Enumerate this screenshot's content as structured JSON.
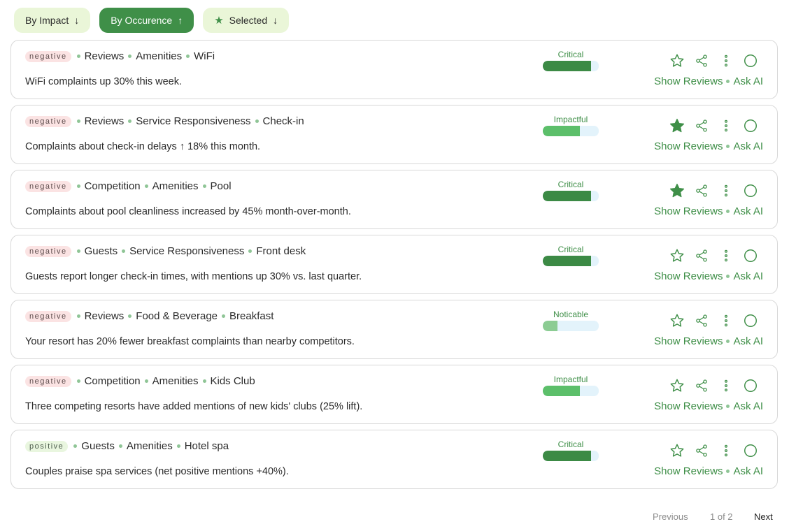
{
  "sort": {
    "by_impact": "By Impact",
    "by_impact_arrow": "↓",
    "by_occurence": "By Occurence",
    "by_occurence_arrow": "↑",
    "selected": "Selected",
    "selected_arrow": "↓",
    "active": "by_occurence"
  },
  "colors": {
    "accent": "#3f8f48",
    "critical": "#3c8a45",
    "impactful": "#5cbf6a",
    "noticable": "#8ccc93",
    "bar_track": "#e3f3fb"
  },
  "links": {
    "show_reviews": "Show Reviews",
    "ask_ai": "Ask AI"
  },
  "insights": [
    {
      "sentiment": "negative",
      "source": "Reviews",
      "category": "Amenities",
      "topic": "WiFi",
      "description": "WiFi complaints up 30% this week.",
      "impact": "Critical",
      "level": 0.86,
      "starred": false
    },
    {
      "sentiment": "negative",
      "source": "Reviews",
      "category": "Service Responsiveness",
      "topic": "Check-in",
      "description": "Complaints about check-in delays ↑ 18% this month.",
      "impact": "Impactful",
      "level": 0.66,
      "starred": true
    },
    {
      "sentiment": "negative",
      "source": "Competition",
      "category": "Amenities",
      "topic": "Pool",
      "description": "Complaints about pool cleanliness increased by 45% month-over-month.",
      "impact": "Critical",
      "level": 0.86,
      "starred": true
    },
    {
      "sentiment": "negative",
      "source": "Guests",
      "category": "Service Responsiveness",
      "topic": "Front desk",
      "description": "Guests report longer check-in times, with mentions up 30% vs. last quarter.",
      "impact": "Critical",
      "level": 0.86,
      "starred": false
    },
    {
      "sentiment": "negative",
      "source": "Reviews",
      "category": "Food & Beverage",
      "topic": "Breakfast",
      "description": "Your resort has 20% fewer breakfast complaints than nearby competitors.",
      "impact": "Noticable",
      "level": 0.26,
      "starred": false
    },
    {
      "sentiment": "negative",
      "source": "Competition",
      "category": "Amenities",
      "topic": "Kids Club",
      "description": "Three competing resorts have added mentions of new kids' clubs (25% lift).",
      "impact": "Impactful",
      "level": 0.66,
      "starred": false
    },
    {
      "sentiment": "positive",
      "source": "Guests",
      "category": "Amenities",
      "topic": "Hotel spa",
      "description": "Couples praise spa services (net positive mentions +40%).",
      "impact": "Critical",
      "level": 0.86,
      "starred": false
    }
  ],
  "pagination": {
    "previous": "Previous",
    "info": "1 of 2",
    "next": "Next"
  }
}
